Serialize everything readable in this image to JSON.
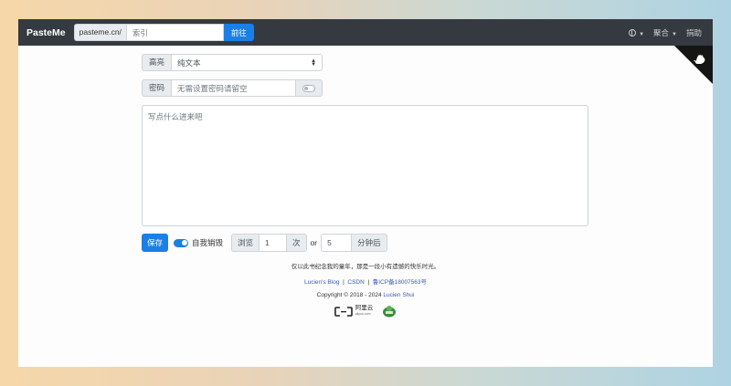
{
  "navbar": {
    "brand": "PasteMe",
    "search_prefix": "pasteme.cn/",
    "search_placeholder": "索引",
    "go_label": "前往",
    "menu_aggregate": "聚合",
    "menu_donate": "捐助",
    "language_icon": "globe-icon"
  },
  "form": {
    "highlight_label": "高亮",
    "highlight_value": "纯文本",
    "password_label": "密码",
    "password_placeholder": "无需设置密码请留空",
    "content_placeholder": "写点什么进来吧"
  },
  "controls": {
    "save_label": "保存",
    "self_destruct_label": "自我销毁",
    "self_destruct_on": true,
    "views_label": "浏览",
    "views_value": "1",
    "times_label": "次",
    "or_label": "or",
    "minutes_value": "5",
    "minutes_label": "分钟后"
  },
  "footer": {
    "dedication": "仅以此书纪念我的童年，那是一段小有遗憾的快乐时光。",
    "link_blog": "Lucien's Blog",
    "sep": "|",
    "link_csdn": "CSDN",
    "link_icp": "鲁ICP备18007563号",
    "copyright": "Copyright © 2018 - 2024",
    "author": "Lucien Shui",
    "sponsor_name": "阿里云",
    "sponsor_domain": "aliyun.com"
  },
  "colors": {
    "navbar_bg": "#343a40",
    "primary": "#1a7fe6",
    "link": "#3a5bb7"
  }
}
